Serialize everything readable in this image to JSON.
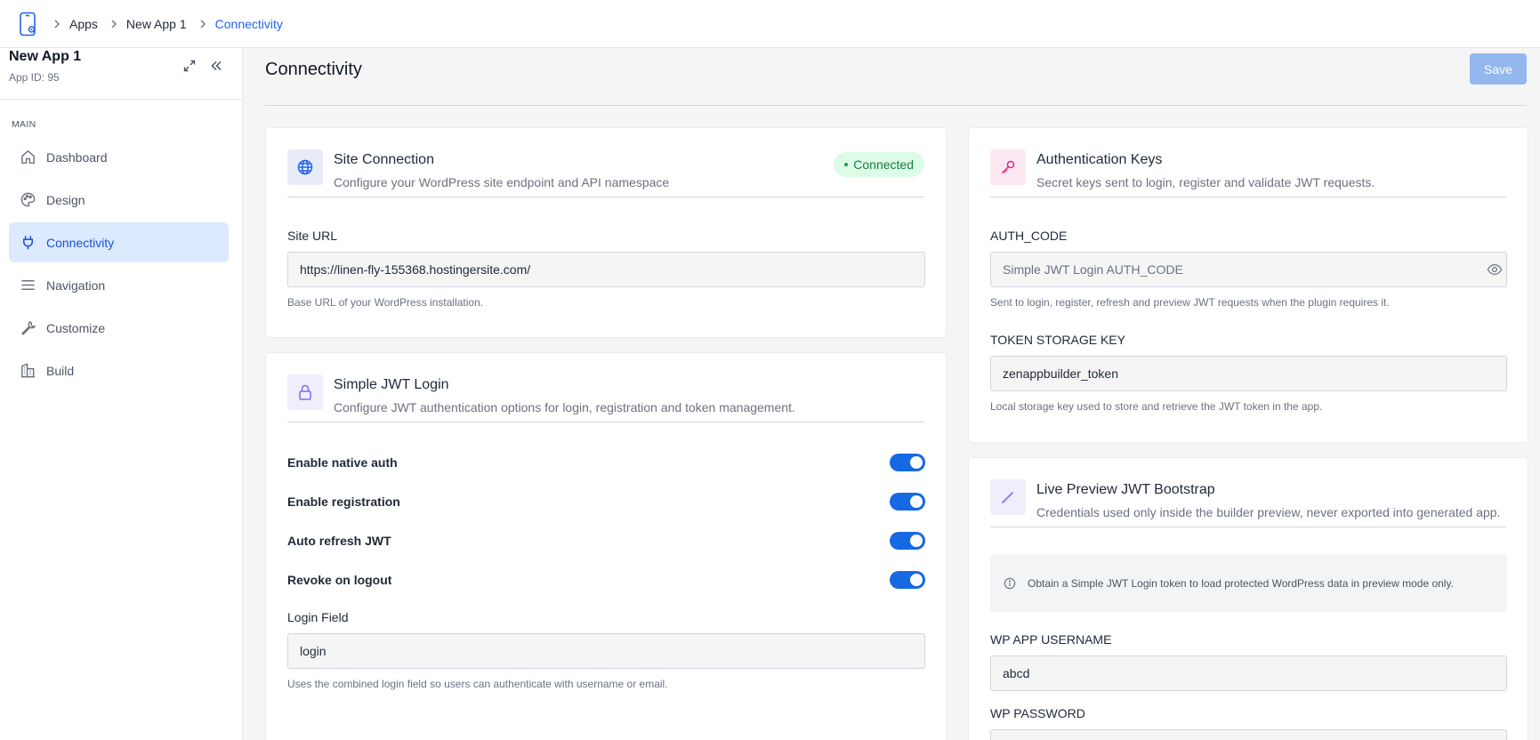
{
  "breadcrumb": {
    "items": [
      "Apps",
      "New App 1",
      "Connectivity"
    ]
  },
  "sidebar": {
    "app_name": "New App 1",
    "app_id": "App ID: 95",
    "section_label": "MAIN",
    "items": [
      {
        "label": "Dashboard",
        "icon": "home-icon"
      },
      {
        "label": "Design",
        "icon": "palette-icon"
      },
      {
        "label": "Connectivity",
        "icon": "plug-icon",
        "active": true
      },
      {
        "label": "Navigation",
        "icon": "menu-icon"
      },
      {
        "label": "Customize",
        "icon": "wrench-icon"
      },
      {
        "label": "Build",
        "icon": "building-icon"
      }
    ]
  },
  "main": {
    "title": "Connectivity",
    "save_label": "Save"
  },
  "site_connection": {
    "title": "Site Connection",
    "description": "Configure your WordPress site endpoint and API namespace",
    "status": "Connected",
    "site_url_label": "Site URL",
    "site_url_value": "https://linen-fly-155368.hostingersite.com/",
    "site_url_hint": "Base URL of your WordPress installation."
  },
  "jwt_login": {
    "title": "Simple JWT Login",
    "description": "Configure JWT authentication options for login, registration and token management.",
    "toggles": [
      {
        "label": "Enable native auth",
        "on": true
      },
      {
        "label": "Enable registration",
        "on": true
      },
      {
        "label": "Auto refresh JWT",
        "on": true
      },
      {
        "label": "Revoke on logout",
        "on": true
      }
    ],
    "login_field_label": "Login Field",
    "login_field_value": "login",
    "login_field_hint": "Uses the combined login field so users can authenticate with username or email."
  },
  "auth_keys": {
    "title": "Authentication Keys",
    "description": "Secret keys sent to login, register and validate JWT requests.",
    "auth_code_label": "AUTH_CODE",
    "auth_code_placeholder": "Simple JWT Login AUTH_CODE",
    "auth_code_hint": "Sent to login, register, refresh and preview JWT requests when the plugin requires it.",
    "token_key_label": "TOKEN STORAGE KEY",
    "token_key_value": "zenappbuilder_token",
    "token_key_hint": "Local storage key used to store and retrieve the JWT token in the app."
  },
  "live_preview": {
    "title": "Live Preview JWT Bootstrap",
    "description": "Credentials used only inside the builder preview, never exported into generated app.",
    "info": "Obtain a Simple JWT Login token to load protected WordPress data in preview mode only.",
    "username_label": "WP APP USERNAME",
    "username_value": "abcd",
    "password_label": "WP PASSWORD"
  },
  "colors": {
    "accent": "#1668e3",
    "active_nav_bg": "#dbeafe",
    "connected_badge_bg": "#dcfce7",
    "connected_badge_text": "#15803d",
    "save_button_disabled": "#93b8f0"
  }
}
